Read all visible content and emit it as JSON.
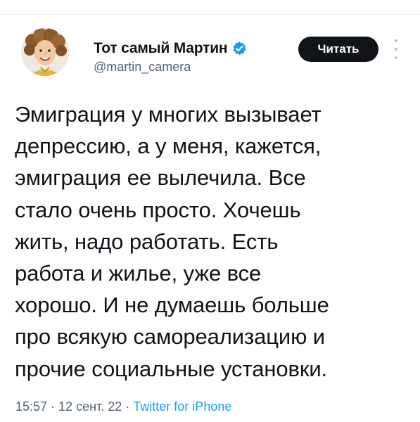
{
  "tweet": {
    "author": {
      "display_name": "Тот самый Мартин",
      "handle": "@martin_camera",
      "verified": true,
      "avatar_icon": "profile-photo"
    },
    "follow_label": "Читать",
    "text": "Эмиграция у многих вызывает\nдепрессию, а у меня, кажется,\nэмиграция ее вылечила. Все\nстало очень просто. Хочешь\nжить, надо работать. Есть\nработа и жилье, уже все\nхорошо. И не думаешь больше\nпро всякую самореализацию и\nпрочие социальные установки.",
    "time": "15:57",
    "date": "12 сент. 22",
    "source": "Twitter for iPhone",
    "separator": "·"
  },
  "colors": {
    "text": "#0f1419",
    "secondary": "#536471",
    "link": "#1d9bf0",
    "verified_badge": "#1d9bf0",
    "follow_button_bg": "#0f1419"
  },
  "icons": {
    "verified": "verified-badge-icon",
    "more": "more-vertical-icon"
  }
}
